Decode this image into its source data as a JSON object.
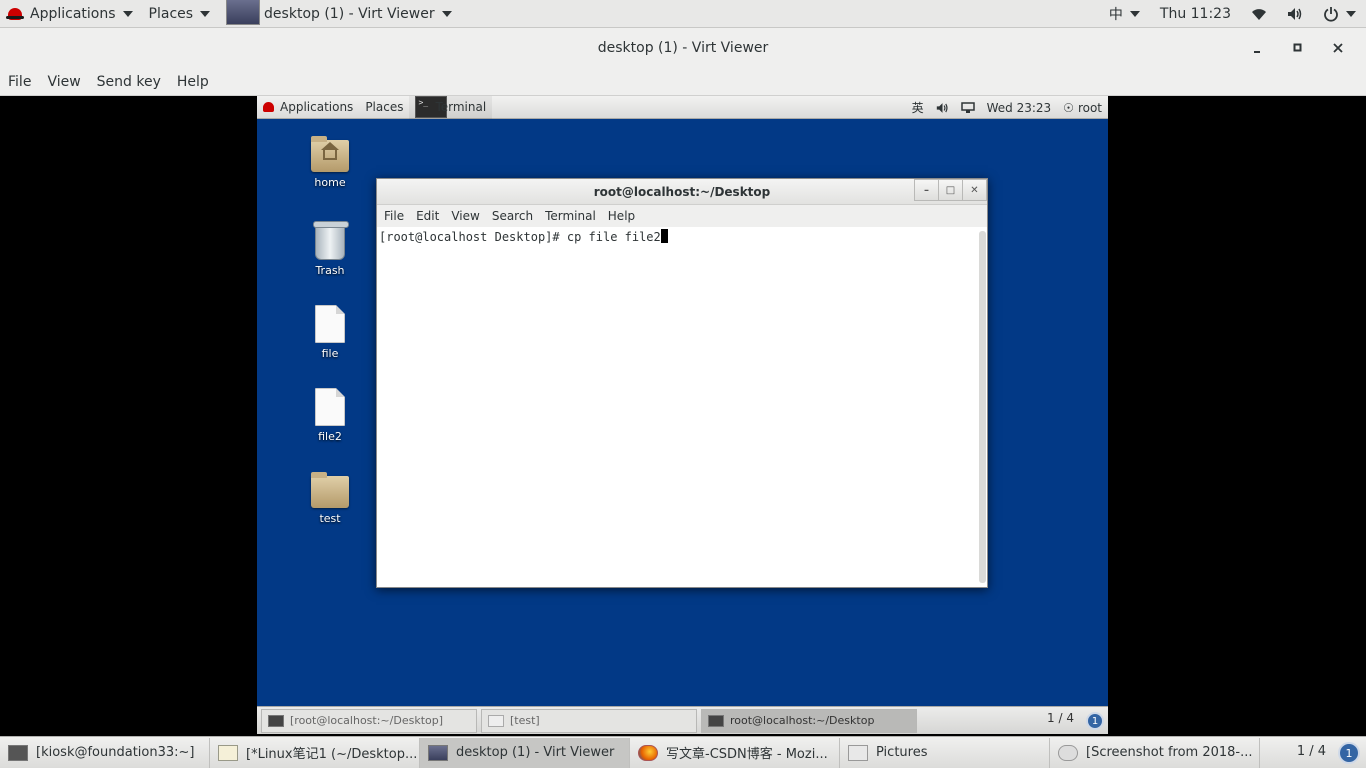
{
  "host_topbar": {
    "applications": "Applications",
    "places": "Places",
    "active_window": "desktop (1) - Virt Viewer",
    "input_method": "中",
    "clock": "Thu 11:23"
  },
  "virt_viewer": {
    "title": "desktop (1) - Virt Viewer",
    "menu": [
      "File",
      "View",
      "Send key",
      "Help"
    ]
  },
  "guest": {
    "topbar": {
      "applications": "Applications",
      "places": "Places",
      "active_app": "Terminal",
      "input_method": "英",
      "clock": "Wed 23:23",
      "user": "root"
    },
    "desktop_icons": [
      {
        "label": "home",
        "icon": "home-folder-icon"
      },
      {
        "label": "Trash",
        "icon": "trash-icon"
      },
      {
        "label": "file",
        "icon": "document-icon"
      },
      {
        "label": "file2",
        "icon": "document-icon"
      },
      {
        "label": "test",
        "icon": "folder-icon"
      }
    ],
    "terminal": {
      "title": "root@localhost:~/Desktop",
      "menu": [
        "File",
        "Edit",
        "View",
        "Search",
        "Terminal",
        "Help"
      ],
      "prompt_line": "[root@localhost Desktop]# cp file file2"
    },
    "taskbar": {
      "tasks": [
        {
          "label": "[root@localhost:~/Desktop]",
          "active": false
        },
        {
          "label": "[test]",
          "active": false
        },
        {
          "label": "root@localhost:~/Desktop",
          "active": true
        }
      ],
      "pager": "1 / 4",
      "badge": "1"
    }
  },
  "host_taskbar": {
    "tasks": [
      {
        "label": "[kiosk@foundation33:~]",
        "icon": "terminal-icon"
      },
      {
        "label": "[*Linux笔记1 (~/Desktop...",
        "icon": "text-editor-icon"
      },
      {
        "label": "desktop (1) - Virt Viewer",
        "icon": "virt-viewer-icon",
        "active": true
      },
      {
        "label": "写文章-CSDN博客 - Mozi...",
        "icon": "firefox-icon"
      },
      {
        "label": "Pictures",
        "icon": "file-manager-icon"
      },
      {
        "label": "[Screenshot from 2018-...",
        "icon": "screenshot-icon"
      }
    ],
    "pager": "1 / 4",
    "badge": "1"
  },
  "colors": {
    "guest_desktop": "#023986",
    "panel": "#e8e8e7"
  }
}
